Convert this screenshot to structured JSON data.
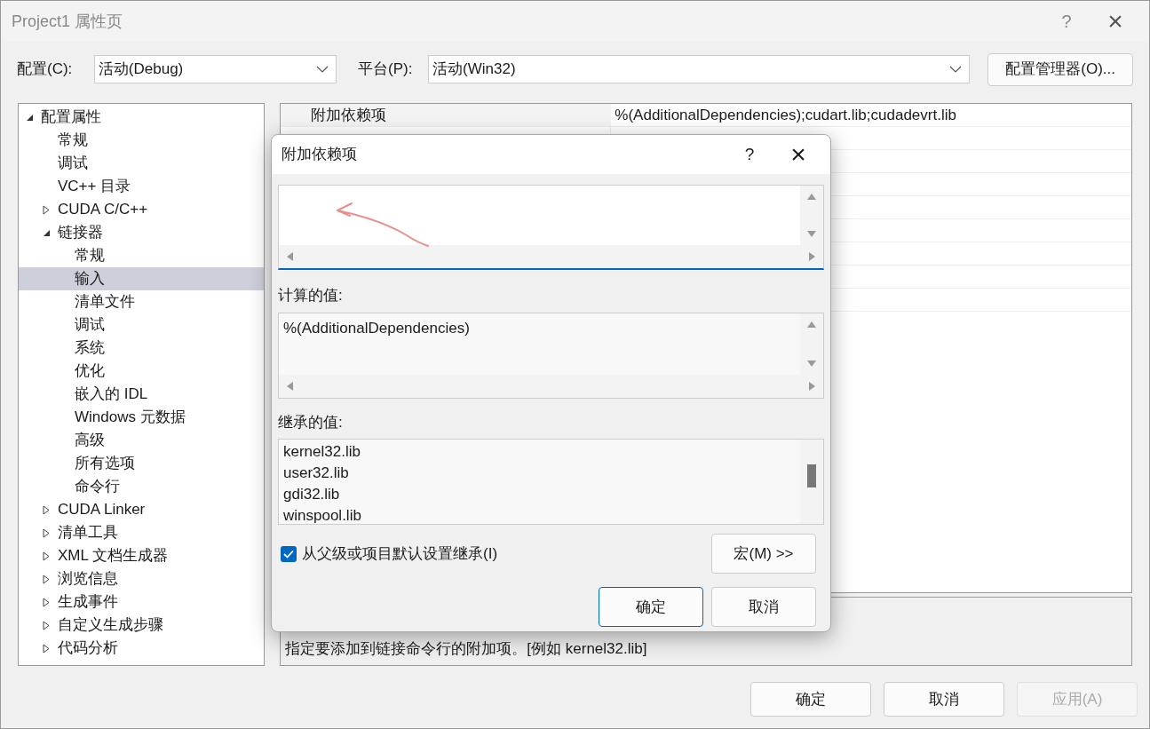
{
  "window": {
    "title": "Project1 属性页",
    "help": "?",
    "close": "×"
  },
  "config": {
    "label": "配置(C):",
    "value": "活动(Debug)"
  },
  "platform": {
    "label": "平台(P):",
    "value": "活动(Win32)"
  },
  "config_manager": "配置管理器(O)...",
  "tree": [
    {
      "label": "配置属性",
      "expanded": true,
      "selected": false,
      "children": [
        {
          "label": "常规",
          "selected": false
        },
        {
          "label": "调试",
          "selected": false
        },
        {
          "label": "VC++ 目录",
          "selected": false
        },
        {
          "label": "CUDA C/C++",
          "expanded": false,
          "selected": false
        },
        {
          "label": "链接器",
          "expanded": true,
          "selected": false,
          "children": [
            {
              "label": "常规",
              "selected": false
            },
            {
              "label": "输入",
              "selected": true
            },
            {
              "label": "清单文件",
              "selected": false
            },
            {
              "label": "调试",
              "selected": false
            },
            {
              "label": "系统",
              "selected": false
            },
            {
              "label": "优化",
              "selected": false
            },
            {
              "label": "嵌入的 IDL",
              "selected": false
            },
            {
              "label": "Windows 元数据",
              "selected": false
            },
            {
              "label": "高级",
              "selected": false
            },
            {
              "label": "所有选项",
              "selected": false
            },
            {
              "label": "命令行",
              "selected": false
            }
          ]
        },
        {
          "label": "CUDA Linker",
          "expanded": false,
          "selected": false
        },
        {
          "label": "清单工具",
          "expanded": false,
          "selected": false
        },
        {
          "label": "XML 文档生成器",
          "expanded": false,
          "selected": false
        },
        {
          "label": "浏览信息",
          "expanded": false,
          "selected": false
        },
        {
          "label": "生成事件",
          "expanded": false,
          "selected": false
        },
        {
          "label": "自定义生成步骤",
          "expanded": false,
          "selected": false
        },
        {
          "label": "代码分析",
          "expanded": false,
          "selected": false
        }
      ]
    }
  ],
  "property_grid": {
    "rows": [
      {
        "name": "附加依赖项",
        "value": "%(AdditionalDependencies);cudart.lib;cudadevrt.lib"
      }
    ]
  },
  "description": "指定要添加到链接命令行的附加项。[例如 kernel32.lib]",
  "buttons": [
    {
      "label": "确定",
      "disabled": false
    },
    {
      "label": "取消",
      "disabled": false
    },
    {
      "label": "应用(A)",
      "disabled": true
    }
  ],
  "dialog": {
    "title": "附加依赖项",
    "help": "?",
    "close": "×",
    "computed_label": "计算的值:",
    "computed_value": "%(AdditionalDependencies)",
    "inherited_label": "继承的值:",
    "inherited_values": [
      "kernel32.lib",
      "user32.lib",
      "gdi32.lib",
      "winspool.lib"
    ],
    "inherit_checkbox": {
      "label": "从父级或项目默认设置继承(I)",
      "checked": true
    },
    "macros_button": "宏(M) >>",
    "buttons": [
      "确定",
      "取消"
    ]
  }
}
